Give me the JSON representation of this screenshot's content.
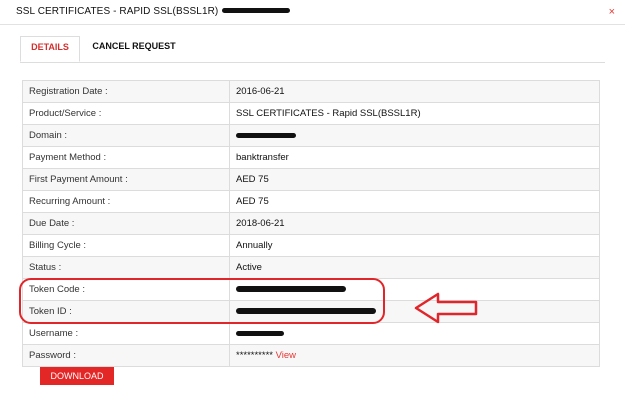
{
  "modal": {
    "title": "SSL CERTIFICATES - RAPID SSL(BSSL1R)",
    "close_label": "×"
  },
  "tabs": [
    {
      "label": "DETAILS",
      "active": true
    },
    {
      "label": "CANCEL REQUEST",
      "active": false
    }
  ],
  "details": [
    {
      "label": "Registration Date :",
      "value": "2016-06-21"
    },
    {
      "label": "Product/Service :",
      "value": "SSL CERTIFICATES - Rapid SSL(BSSL1R)"
    },
    {
      "label": "Domain :",
      "value": ""
    },
    {
      "label": "Payment Method :",
      "value": "banktransfer"
    },
    {
      "label": "First Payment Amount :",
      "value": "AED 75"
    },
    {
      "label": "Recurring Amount :",
      "value": "AED 75"
    },
    {
      "label": "Due Date :",
      "value": "2018-06-21"
    },
    {
      "label": "Billing Cycle :",
      "value": "Annually"
    },
    {
      "label": "Status :",
      "value": "Active"
    },
    {
      "label": "Token Code :",
      "value": ""
    },
    {
      "label": "Token ID :",
      "value": ""
    },
    {
      "label": "Username :",
      "value": ""
    },
    {
      "label": "Password :",
      "value": "**********",
      "link": "View"
    }
  ],
  "download_label": "DOWNLOAD",
  "colors": {
    "accent": "#e32626",
    "annotation": "#e0262a"
  }
}
